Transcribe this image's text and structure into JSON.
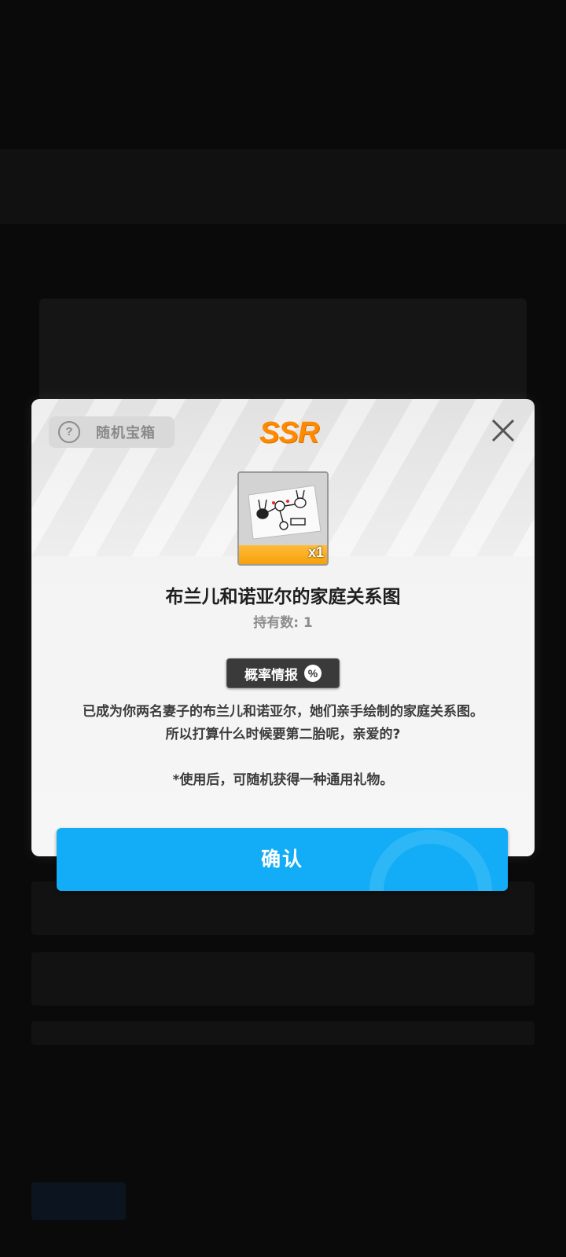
{
  "dialog": {
    "category_label": "随机宝箱",
    "category_icon": "question-circle-icon",
    "rarity": "SSR",
    "rarity_color": "#ff8a00",
    "close_icon": "close-icon",
    "item": {
      "quantity_label": "x1",
      "name": "布兰儿和诺亚尔的家庭关系图",
      "owned": "持有数: 1"
    },
    "probability_button": {
      "label": "概率情报",
      "icon": "percent-icon"
    },
    "description": [
      "已成为你两名妻子的布兰儿和诺亚尔，她们亲手绘制的家庭关系图。",
      "所以打算什么时候要第二胎呢，亲爱的?"
    ],
    "note": "*使用后，可随机获得一种通用礼物。",
    "confirm_label": "确认",
    "confirm_color": "#12adf6"
  }
}
